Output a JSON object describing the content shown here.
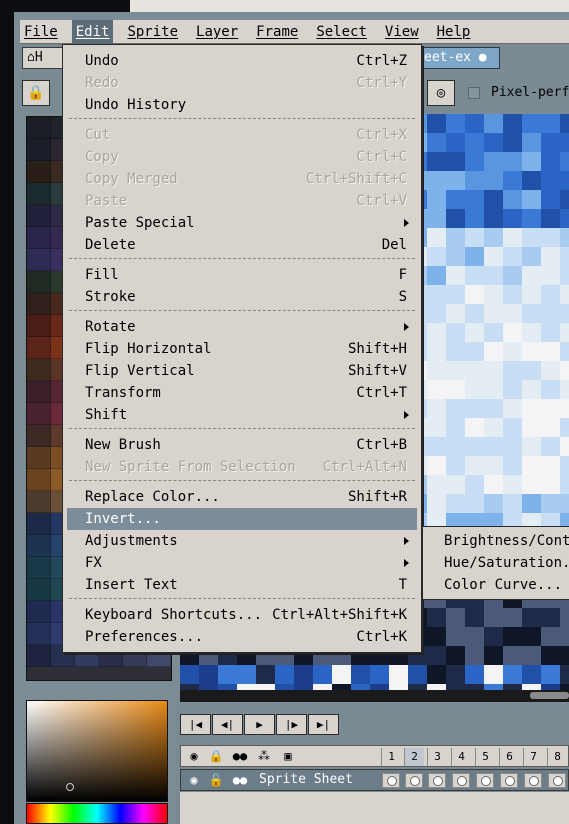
{
  "menubar": {
    "items": [
      "File",
      "Edit",
      "Sprite",
      "Layer",
      "Frame",
      "Select",
      "View",
      "Help"
    ],
    "active": "Edit"
  },
  "tabs": {
    "home_label": "H",
    "file_label": "eet-ex"
  },
  "toolbar": {
    "pixel_perfect_label": "Pixel-perfec"
  },
  "edit_menu": {
    "items": [
      {
        "label": "Undo",
        "shortcut": "Ctrl+Z",
        "disabled": false
      },
      {
        "label": "Redo",
        "shortcut": "Ctrl+Y",
        "disabled": true
      },
      {
        "label": "Undo History",
        "shortcut": "",
        "disabled": false
      },
      {
        "label": "Cut",
        "shortcut": "Ctrl+X",
        "disabled": true
      },
      {
        "label": "Copy",
        "shortcut": "Ctrl+C",
        "disabled": true
      },
      {
        "label": "Copy Merged",
        "shortcut": "Ctrl+Shift+C",
        "disabled": true
      },
      {
        "label": "Paste",
        "shortcut": "Ctrl+V",
        "disabled": true
      },
      {
        "label": "Paste Special",
        "shortcut": "",
        "disabled": false,
        "submenu": true
      },
      {
        "label": "Delete",
        "shortcut": "Del",
        "disabled": false
      },
      {
        "label": "Fill",
        "shortcut": "F",
        "disabled": false
      },
      {
        "label": "Stroke",
        "shortcut": "S",
        "disabled": false
      },
      {
        "label": "Rotate",
        "shortcut": "",
        "disabled": false,
        "submenu": true
      },
      {
        "label": "Flip Horizontal",
        "shortcut": "Shift+H",
        "disabled": false
      },
      {
        "label": "Flip Vertical",
        "shortcut": "Shift+V",
        "disabled": false
      },
      {
        "label": "Transform",
        "shortcut": "Ctrl+T",
        "disabled": false
      },
      {
        "label": "Shift",
        "shortcut": "",
        "disabled": false,
        "submenu": true
      },
      {
        "label": "New Brush",
        "shortcut": "Ctrl+B",
        "disabled": false
      },
      {
        "label": "New Sprite From Selection",
        "shortcut": "Ctrl+Alt+N",
        "disabled": true
      },
      {
        "label": "Replace Color...",
        "shortcut": "Shift+R",
        "disabled": false
      },
      {
        "label": "Invert...",
        "shortcut": "",
        "disabled": false,
        "highlighted": true
      },
      {
        "label": "Adjustments",
        "shortcut": "",
        "disabled": false,
        "submenu": true
      },
      {
        "label": "FX",
        "shortcut": "",
        "disabled": false,
        "submenu": true
      },
      {
        "label": "Insert Text",
        "shortcut": "T",
        "disabled": false
      },
      {
        "label": "Keyboard Shortcuts...",
        "shortcut": "Ctrl+Alt+Shift+K",
        "disabled": false
      },
      {
        "label": "Preferences...",
        "shortcut": "Ctrl+K",
        "disabled": false
      }
    ]
  },
  "adjustments_submenu": {
    "items": [
      "Brightness/Cont",
      "Hue/Saturation...",
      "Color Curve..."
    ]
  },
  "timeline": {
    "frame_numbers": [
      "1",
      "2",
      "3",
      "4",
      "5",
      "6",
      "7",
      "8"
    ],
    "current_frame": "2",
    "layer_name": "Sprite Sheet"
  },
  "colors": {
    "menu_bg": "#d8d3cd",
    "highlight": "#7c8c98",
    "window_chrome": "#7a8a93",
    "canvas_blue": "#2b6fd0"
  },
  "icons": {
    "home": "home-icon",
    "lock": "lock-icon",
    "pixel_perfect": "magnifier-icon",
    "eye": "eye-icon",
    "padlock": "padlock-icon",
    "continuous": "link-dots-icon"
  }
}
